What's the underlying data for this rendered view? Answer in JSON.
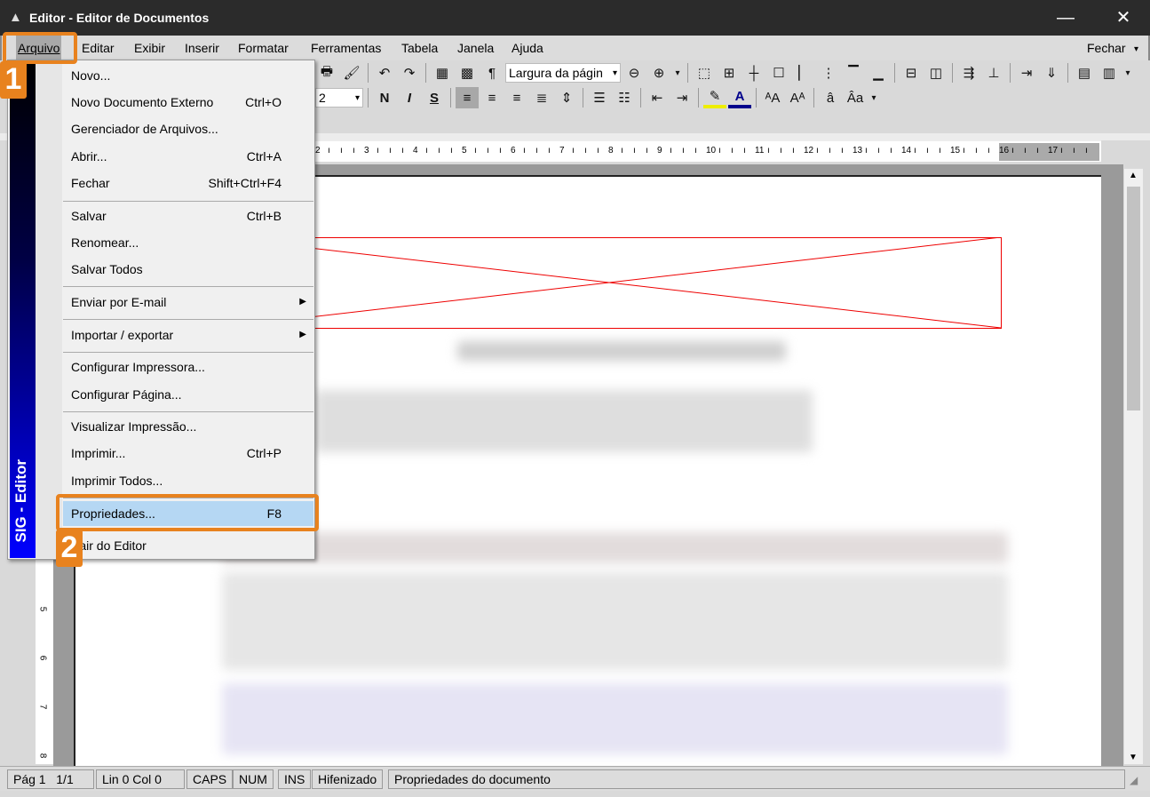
{
  "window": {
    "title": "Editor - Editor de Documentos",
    "minimize_icon": "minimize-icon",
    "close_icon": "close-icon"
  },
  "menubar": {
    "items": [
      "Arquivo",
      "Editar",
      "Exibir",
      "Inserir",
      "Formatar",
      "Ferramentas",
      "Tabela",
      "Janela",
      "Ajuda"
    ],
    "close_label": "Fechar"
  },
  "toolbar": {
    "zoom_value": "Largura da págin",
    "font_size": "2",
    "row1": [
      "print",
      "format-painter",
      "|",
      "undo",
      "redo",
      "|",
      "table",
      "merge-cells",
      "pilcrow",
      "ZOOM",
      "zoom-out",
      "zoom-in",
      "more",
      "|",
      "border-none",
      "border-all",
      "border-inner",
      "border-outer",
      "border-left",
      "border-vertical",
      "border-top",
      "border-bottom",
      "|",
      "insert-row",
      "insert-column",
      "|",
      "split-cell",
      "split-tree",
      "|",
      "move-right",
      "move-down",
      "|",
      "grid-1",
      "grid-2",
      "more"
    ],
    "row2": [
      "SIZE",
      "|",
      "bold",
      "italic",
      "underline",
      "|",
      "align-left",
      "align-center",
      "align-right",
      "justify",
      "line-spacing",
      "|",
      "bullets",
      "numbering",
      "|",
      "outdent",
      "indent",
      "|",
      "highlight",
      "font-color",
      "|",
      "grow-font",
      "shrink-font",
      "|",
      "superscript",
      "subscript",
      "more"
    ]
  },
  "ruler": {
    "labels": [
      "2",
      "3",
      "4",
      "5",
      "6",
      "7",
      "8",
      "9",
      "10",
      "11",
      "12",
      "13",
      "14",
      "15",
      "16",
      "17"
    ],
    "vlabels": [
      "5",
      "6",
      "7",
      "8"
    ]
  },
  "file_menu": {
    "sidebar_label": "SIG - Editor",
    "items": [
      {
        "label": "Novo...",
        "shortcut": ""
      },
      {
        "label": "Novo Documento Externo",
        "shortcut": "Ctrl+O"
      },
      {
        "label": "Gerenciador de Arquivos...",
        "shortcut": ""
      },
      {
        "label": "Abrir...",
        "shortcut": "Ctrl+A"
      },
      {
        "label": "Fechar",
        "shortcut": "Shift+Ctrl+F4"
      },
      {
        "label": "Salvar",
        "shortcut": "Ctrl+B"
      },
      {
        "label": "Renomear...",
        "shortcut": ""
      },
      {
        "label": "Salvar Todos",
        "shortcut": ""
      },
      {
        "label": "Enviar por E-mail",
        "shortcut": "",
        "submenu": true
      },
      {
        "label": "Importar / exportar",
        "shortcut": "",
        "submenu": true
      },
      {
        "label": "Configurar Impressora...",
        "shortcut": ""
      },
      {
        "label": "Configurar Página...",
        "shortcut": ""
      },
      {
        "label": "Visualizar Impressão...",
        "shortcut": ""
      },
      {
        "label": "Imprimir...",
        "shortcut": "Ctrl+P"
      },
      {
        "label": "Imprimir Todos...",
        "shortcut": ""
      },
      {
        "label": "Propriedades...",
        "shortcut": "F8",
        "highlighted": true
      },
      {
        "label": "Sair do Editor",
        "shortcut": ""
      }
    ]
  },
  "callouts": {
    "step1": "1",
    "step2": "2",
    "color": "#e8821e"
  },
  "statusbar": {
    "page": "Pág 1",
    "pages": "1/1",
    "position": "Lin 0  Col 0",
    "caps": "CAPS",
    "num": "NUM",
    "ins": "INS",
    "hyphen": "Hifenizado",
    "message": "Propriedades do documento"
  }
}
